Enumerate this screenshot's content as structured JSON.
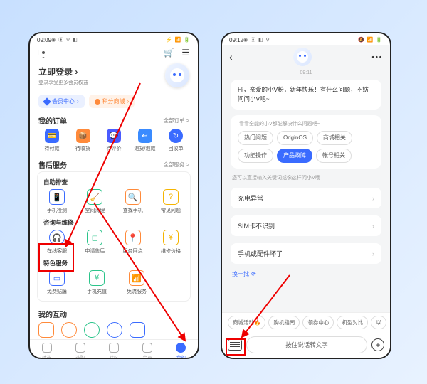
{
  "left": {
    "status": {
      "time": "09:09",
      "icons_left": "◉ ⦿ ⚲ ◧",
      "icons_right": "⚡ 📶 🔋"
    },
    "login": {
      "title": "立即登录",
      "sub": "登录享受更多会员权益"
    },
    "pills": {
      "member": "会员中心",
      "points": "积分商城"
    },
    "orders": {
      "title": "我的订单",
      "more": "全部订单 >",
      "items": [
        {
          "label": "待付款",
          "glyph": "💳"
        },
        {
          "label": "待收货",
          "glyph": "📦"
        },
        {
          "label": "待评价",
          "glyph": "💬"
        },
        {
          "label": "退货/退款",
          "glyph": "↩"
        },
        {
          "label": "回收单",
          "glyph": "↻"
        }
      ]
    },
    "aftersale": {
      "title": "售后服务",
      "more": "全部服务 >",
      "group1": {
        "title": "自助排查",
        "items": [
          {
            "label": "手机检测",
            "glyph": "📱"
          },
          {
            "label": "空间清理",
            "glyph": "🧹"
          },
          {
            "label": "查找手机",
            "glyph": "🔍"
          },
          {
            "label": "常见问题",
            "glyph": "?"
          }
        ]
      },
      "group2": {
        "title": "咨询与维修",
        "items": [
          {
            "label": "在线客服",
            "glyph": "🎧"
          },
          {
            "label": "申请售后",
            "glyph": "◻"
          },
          {
            "label": "服务网点",
            "glyph": "📍"
          },
          {
            "label": "维修价格",
            "glyph": "¥"
          }
        ]
      },
      "group3": {
        "title": "特色服务",
        "items": [
          {
            "label": "免费贴膜",
            "glyph": "▭"
          },
          {
            "label": "手机充值",
            "glyph": "¥"
          },
          {
            "label": "免流服务",
            "glyph": "📶"
          }
        ]
      }
    },
    "interact": {
      "title": "我的互动"
    },
    "nav": [
      {
        "label": "精选"
      },
      {
        "label": "选购"
      },
      {
        "label": "社区"
      },
      {
        "label": "会员"
      },
      {
        "label": "我的"
      }
    ]
  },
  "right": {
    "status": {
      "time": "09:12",
      "icons_left": "◉ ⦿ ◧ ⚲",
      "icons_right": "🔕 📶 🔋"
    },
    "header_time": "09:11",
    "greeting": "Hi，亲爱的小V粉，新年快乐！有什么问题，不妨问问小V吧~",
    "hint1": "看看全能的小V都能解决什么问题吧~",
    "chips": [
      {
        "label": "热门问题"
      },
      {
        "label": "OriginOS"
      },
      {
        "label": "商城相关"
      },
      {
        "label": "功能操作"
      },
      {
        "label": "产品故障",
        "active": true
      },
      {
        "label": "帐号相关"
      }
    ],
    "hint2": "您可以直接输入关键词或像这样问小V哦",
    "faq": [
      "充电异常",
      "SIM卡不识别",
      "手机或配件坏了"
    ],
    "refresh": "换一批",
    "suggestions": [
      "商城活动🔥",
      "购机指南",
      "领券中心",
      "机型对比",
      "以"
    ],
    "voice_placeholder": "按住说话转文字"
  }
}
